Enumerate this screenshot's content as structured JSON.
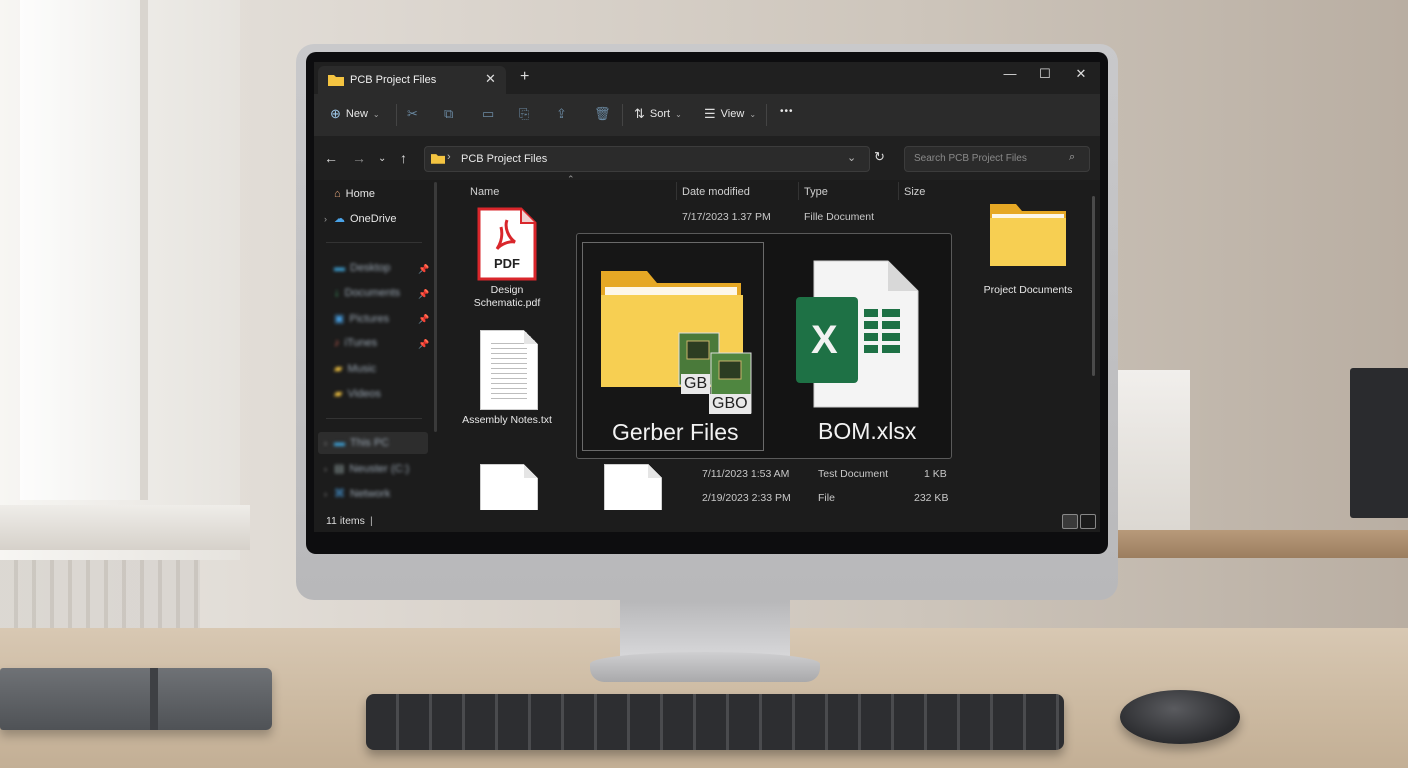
{
  "window": {
    "tab_title": "PCB Project Files",
    "new_tab": "+",
    "close_tab": "✕",
    "minimize": "—",
    "maximize": "☐",
    "close": "✕"
  },
  "toolbar": {
    "new_label": "New",
    "sort_label": "Sort",
    "view_label": "View",
    "more": "•••"
  },
  "address": {
    "path": "PCB Project Files",
    "search_placeholder": "Search PCB Project Files"
  },
  "sidebar": {
    "home": "Home",
    "onedrive": "OneDrive",
    "quick": [
      {
        "label": "Desktop",
        "icon": "desktop-icon"
      },
      {
        "label": "Documents",
        "icon": "download-icon"
      },
      {
        "label": "Pictures",
        "icon": "pictures-icon"
      },
      {
        "label": "iTunes",
        "icon": "music-icon"
      },
      {
        "label": "Music",
        "icon": "folder-icon"
      },
      {
        "label": "Videos",
        "icon": "folder-icon"
      }
    ],
    "this_pc": "This PC",
    "drive": "Neuster (C:)",
    "network": "Network"
  },
  "columns": {
    "name": "Name",
    "date": "Date modified",
    "type": "Type",
    "size": "Size"
  },
  "files": {
    "pdf_badge": "PDF",
    "pdf_name": "Design Schematic.pdf",
    "pdf_date": "7/17/2023 1.37 PM",
    "pdf_type": "Fille Document",
    "txt_name": "Assembly Notes.txt",
    "folder_name": "Project Documents",
    "row3_date": "7/11/2023 1:53 AM",
    "row3_type": "Test Document",
    "row3_size": "1 KB",
    "row4_date": "2/19/2023 2:33 PM",
    "row4_type": "File",
    "row4_size": "232 KB"
  },
  "featured": {
    "gerber_name": "Gerber Files",
    "gerber_badge1": "GB",
    "gerber_badge2": "GBO",
    "bom_name": "BOM.xlsx",
    "excel_letter": "X"
  },
  "status": {
    "items": "11 items"
  },
  "colors": {
    "folder": "#f4c441",
    "excel": "#1e7145",
    "pdf_red": "#d9262b",
    "accent": "#9ec7e8"
  }
}
